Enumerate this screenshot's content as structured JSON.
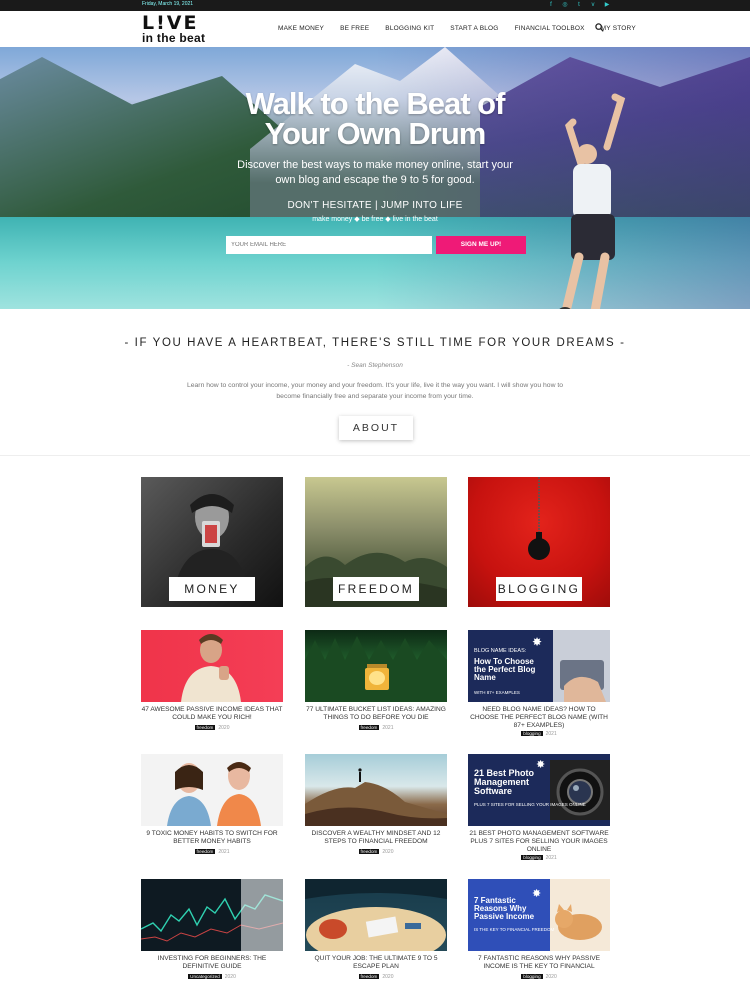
{
  "topbar": {
    "date": "Friday, March 19, 2021",
    "social_icons": [
      "facebook-icon",
      "instagram-icon",
      "twitter-icon",
      "vimeo-icon",
      "youtube-icon"
    ]
  },
  "header": {
    "logo_top": "L!VE",
    "logo_bottom": "in the beat",
    "nav": [
      "MAKE MONEY",
      "BE FREE",
      "BLOGGING KIT",
      "START A BLOG",
      "FINANCIAL TOOLBOX",
      "MY STORY"
    ]
  },
  "hero": {
    "title": "Walk to the Beat of Your Own Drum",
    "subtitle": "Discover the best ways to make money online, start your own blog and escape the 9 to 5 for good.",
    "tagline": "DON'T HESITATE | JUMP INTO LIFE",
    "tagline2": "make money ◆ be free ◆ live in the beat",
    "email_placeholder": "YOUR EMAIL HERE",
    "signup_label": "SIGN ME UP!"
  },
  "quote": {
    "text": "- IF YOU HAVE A HEARTBEAT, THERE'S STILL TIME FOR YOUR DREAMS -",
    "author": "- Sean Stephenson",
    "intro": "Learn how to control your income, your money and your freedom. It's your life, live it the way you want. I will show you how to become financially free and separate your income from your time.",
    "about_label": "ABOUT"
  },
  "categories": [
    "MONEY",
    "FREEDOM",
    "BLOGGING"
  ],
  "posts": [
    {
      "title": "47 AWESOME PASSIVE INCOME IDEAS THAT COULD MAKE YOU RICH!",
      "tag": "freedom",
      "year": "2020"
    },
    {
      "title": "77 ULTIMATE BUCKET LIST IDEAS: AMAZING THINGS TO DO BEFORE YOU DIE",
      "tag": "freedom",
      "year": "2021"
    },
    {
      "title": "NEED BLOG NAME IDEAS? HOW TO CHOOSE THE PERFECT BLOG NAME (WITH 87+ EXAMPLES)",
      "tag": "blogging",
      "year": "2021"
    },
    {
      "title": "9 TOXIC MONEY HABITS TO SWITCH FOR BETTER MONEY HABITS",
      "tag": "freedom",
      "year": "2021"
    },
    {
      "title": "DISCOVER A WEALTHY MINDSET AND 12 STEPS TO FINANCIAL FREEDOM",
      "tag": "freedom",
      "year": "2020"
    },
    {
      "title": "21 BEST PHOTO MANAGEMENT SOFTWARE PLUS 7 SITES FOR SELLING YOUR IMAGES ONLINE",
      "tag": "blogging",
      "year": "2021"
    },
    {
      "title": "INVESTING FOR BEGINNERS: THE DEFINITIVE GUIDE",
      "tag": "Uncategorized",
      "year": "2020"
    },
    {
      "title": "QUIT YOUR JOB: THE ULTIMATE 9 TO 5 ESCAPE PLAN",
      "tag": "freedom",
      "year": "2020"
    },
    {
      "title": "7 FANTASTIC REASONS WHY PASSIVE INCOME IS THE KEY TO FINANCIAL",
      "tag": "blogging",
      "year": "2020"
    }
  ],
  "thumb_text": {
    "blog_name": {
      "kicker": "BLOG NAME IDEAS:",
      "headline": "How To Choose the Perfect Blog Name",
      "footer": "WITH 87+ EXAMPLES"
    },
    "photo": {
      "headline": "21 Best Photo Management Software",
      "footer": "PLUS 7 SITES FOR SELLING YOUR IMAGES ONLINE"
    },
    "passive": {
      "headline": "7 Fantastic Reasons Why Passive Income",
      "footer": "IS THE KEY TO FINANCIAL FREEDOM"
    }
  },
  "colors": {
    "accent": "#ef1a77",
    "topbar": "#1a1a1a",
    "teal": "#33cccc"
  }
}
